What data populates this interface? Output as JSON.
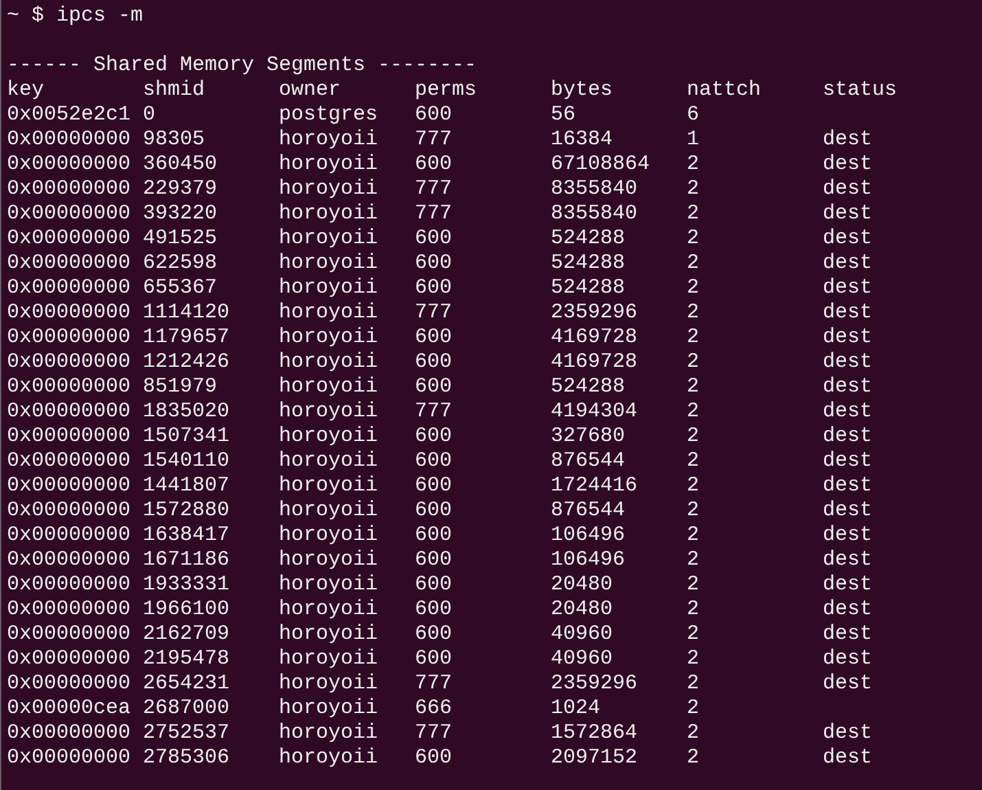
{
  "terminal": {
    "prompt": "~ $ ipcs -m",
    "section_title": "------ Shared Memory Segments --------",
    "table": {
      "columns": [
        "key",
        "shmid",
        "owner",
        "perms",
        "bytes",
        "nattch",
        "status"
      ],
      "rows": [
        [
          "0x0052e2c1",
          "0",
          "postgres",
          "600",
          "56",
          "6"
        ],
        [
          "0x00000000",
          "98305",
          "horoyoii",
          "777",
          "16384",
          "1",
          "dest"
        ],
        [
          "0x00000000",
          "360450",
          "horoyoii",
          "600",
          "67108864",
          "2",
          "dest"
        ],
        [
          "0x00000000",
          "229379",
          "horoyoii",
          "777",
          "8355840",
          "2",
          "dest"
        ],
        [
          "0x00000000",
          "393220",
          "horoyoii",
          "777",
          "8355840",
          "2",
          "dest"
        ],
        [
          "0x00000000",
          "491525",
          "horoyoii",
          "600",
          "524288",
          "2",
          "dest"
        ],
        [
          "0x00000000",
          "622598",
          "horoyoii",
          "600",
          "524288",
          "2",
          "dest"
        ],
        [
          "0x00000000",
          "655367",
          "horoyoii",
          "600",
          "524288",
          "2",
          "dest"
        ],
        [
          "0x00000000",
          "1114120",
          "horoyoii",
          "777",
          "2359296",
          "2",
          "dest"
        ],
        [
          "0x00000000",
          "1179657",
          "horoyoii",
          "600",
          "4169728",
          "2",
          "dest"
        ],
        [
          "0x00000000",
          "1212426",
          "horoyoii",
          "600",
          "4169728",
          "2",
          "dest"
        ],
        [
          "0x00000000",
          "851979",
          "horoyoii",
          "600",
          "524288",
          "2",
          "dest"
        ],
        [
          "0x00000000",
          "1835020",
          "horoyoii",
          "777",
          "4194304",
          "2",
          "dest"
        ],
        [
          "0x00000000",
          "1507341",
          "horoyoii",
          "600",
          "327680",
          "2",
          "dest"
        ],
        [
          "0x00000000",
          "1540110",
          "horoyoii",
          "600",
          "876544",
          "2",
          "dest"
        ],
        [
          "0x00000000",
          "1441807",
          "horoyoii",
          "600",
          "1724416",
          "2",
          "dest"
        ],
        [
          "0x00000000",
          "1572880",
          "horoyoii",
          "600",
          "876544",
          "2",
          "dest"
        ],
        [
          "0x00000000",
          "1638417",
          "horoyoii",
          "600",
          "106496",
          "2",
          "dest"
        ],
        [
          "0x00000000",
          "1671186",
          "horoyoii",
          "600",
          "106496",
          "2",
          "dest"
        ],
        [
          "0x00000000",
          "1933331",
          "horoyoii",
          "600",
          "20480",
          "2",
          "dest"
        ],
        [
          "0x00000000",
          "1966100",
          "horoyoii",
          "600",
          "20480",
          "2",
          "dest"
        ],
        [
          "0x00000000",
          "2162709",
          "horoyoii",
          "600",
          "40960",
          "2",
          "dest"
        ],
        [
          "0x00000000",
          "2195478",
          "horoyoii",
          "600",
          "40960",
          "2",
          "dest"
        ],
        [
          "0x00000000",
          "2654231",
          "horoyoii",
          "777",
          "2359296",
          "2",
          "dest"
        ],
        [
          "0x00000cea",
          "2687000",
          "horoyoii",
          "666",
          "1024",
          "2"
        ],
        [
          "0x00000000",
          "2752537",
          "horoyoii",
          "777",
          "1572864",
          "2",
          "dest"
        ],
        [
          "0x00000000",
          "2785306",
          "horoyoii",
          "600",
          "2097152",
          "2",
          "dest"
        ]
      ]
    }
  }
}
